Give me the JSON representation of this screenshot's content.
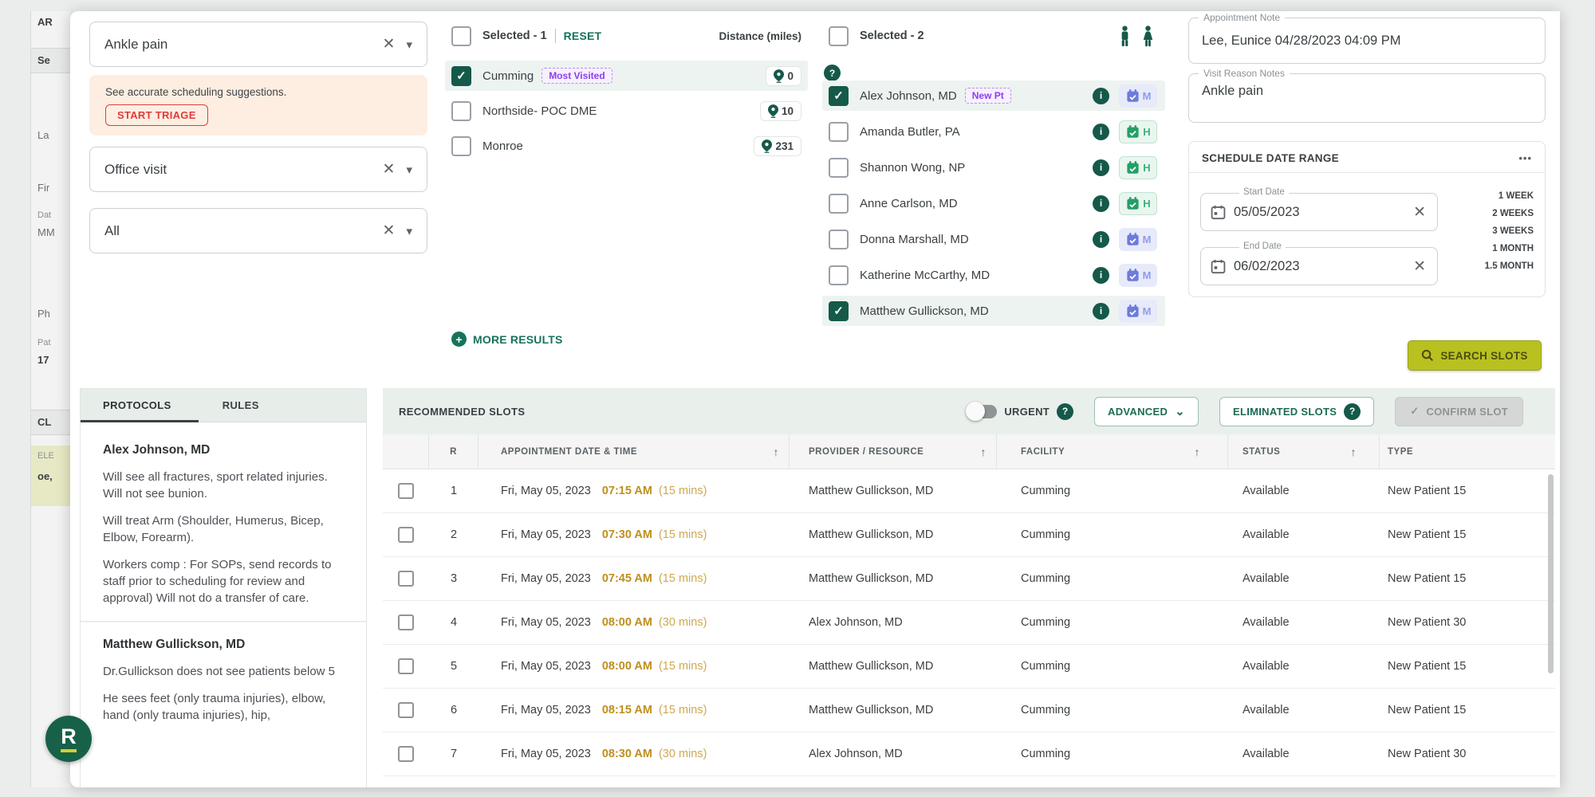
{
  "background_form": {
    "fragments": [
      "AR",
      "Se",
      "La",
      "Fir",
      "Dat",
      "MM",
      "Ph",
      "Pat",
      "17",
      "CL",
      "ELE",
      "oe,"
    ]
  },
  "filters": {
    "visit_reason": {
      "value": "Ankle pain"
    },
    "triage": {
      "message": "See accurate scheduling suggestions.",
      "button": "START TRIAGE"
    },
    "appointment_type": {
      "value": "Office visit"
    },
    "provider_type": {
      "value": "All"
    }
  },
  "locations": {
    "selected_label": "Selected  - 1",
    "reset_label": "RESET",
    "distance_header": "Distance (miles)",
    "more_results_label": "MORE RESULTS",
    "items": [
      {
        "name": "Cumming",
        "badge": "Most Visited",
        "distance": "0"
      },
      {
        "name": "Northside- POC DME",
        "distance": "10"
      },
      {
        "name": "Monroe",
        "distance": "231"
      }
    ]
  },
  "providers": {
    "selected_label": "Selected  - 2",
    "items": [
      {
        "name": "Alex Johnson, MD",
        "badge": "New Pt",
        "calendar_letter": "M"
      },
      {
        "name": "Amanda Butler, PA",
        "calendar_letter": "H"
      },
      {
        "name": "Shannon Wong, NP",
        "calendar_letter": "H"
      },
      {
        "name": "Anne Carlson, MD",
        "calendar_letter": "H"
      },
      {
        "name": "Donna Marshall, MD",
        "calendar_letter": "M"
      },
      {
        "name": "Katherine McCarthy, MD",
        "calendar_letter": "M"
      },
      {
        "name": "Matthew Gullickson, MD",
        "calendar_letter": "M"
      }
    ]
  },
  "notes": {
    "appointment_note": {
      "label": "Appointment Note",
      "value": "Lee, Eunice 04/28/2023 04:09 PM"
    },
    "visit_reason_notes": {
      "label": "Visit Reason Notes",
      "value": "Ankle pain"
    }
  },
  "date_range": {
    "title": "SCHEDULE DATE RANGE",
    "start": {
      "label": "Start Date",
      "value": "05/05/2023"
    },
    "end": {
      "label": "End Date",
      "value": "06/02/2023"
    },
    "quick_links": [
      "1 WEEK",
      "2 WEEKS",
      "3 WEEKS",
      "1 MONTH",
      "1.5 MONTH"
    ]
  },
  "search_button_label": "SEARCH SLOTS",
  "protocols": {
    "tabs": [
      {
        "label": "PROTOCOLS"
      },
      {
        "label": "RULES"
      }
    ],
    "sections": [
      {
        "provider": "Alex Johnson, MD",
        "paragraphs": [
          "Will see all fractures, sport related injuries. Will not see bunion.",
          "Will treat Arm (Shoulder, Humerus, Bicep, Elbow, Forearm).",
          "Workers comp : For SOPs, send records to staff prior to scheduling for review and approval) Will not do a transfer of care."
        ]
      },
      {
        "provider": "Matthew Gullickson, MD",
        "paragraphs": [
          "Dr.Gullickson does not see patients below 5",
          "He sees feet (only trauma injuries), elbow, hand (only trauma injuries), hip,"
        ]
      }
    ]
  },
  "slots": {
    "title": "RECOMMENDED SLOTS",
    "urgent_label": "URGENT",
    "advanced_label": "ADVANCED",
    "eliminated_label": "ELIMINATED SLOTS",
    "confirm_label": "CONFIRM SLOT",
    "columns": {
      "r": "R",
      "appointment": "APPOINTMENT DATE & TIME",
      "provider": "PROVIDER / RESOURCE",
      "facility": "FACILITY",
      "status": "STATUS",
      "type": "TYPE"
    },
    "rows": [
      {
        "r": "1",
        "date": "Fri, May 05, 2023",
        "time": "07:15 AM",
        "duration": "(15 mins)",
        "provider": "Matthew Gullickson, MD",
        "facility": "Cumming",
        "status": "Available",
        "type": "New Patient 15"
      },
      {
        "r": "2",
        "date": "Fri, May 05, 2023",
        "time": "07:30 AM",
        "duration": "(15 mins)",
        "provider": "Matthew Gullickson, MD",
        "facility": "Cumming",
        "status": "Available",
        "type": "New Patient 15"
      },
      {
        "r": "3",
        "date": "Fri, May 05, 2023",
        "time": "07:45 AM",
        "duration": "(15 mins)",
        "provider": "Matthew Gullickson, MD",
        "facility": "Cumming",
        "status": "Available",
        "type": "New Patient 15"
      },
      {
        "r": "4",
        "date": "Fri, May 05, 2023",
        "time": "08:00 AM",
        "duration": "(30 mins)",
        "provider": "Alex Johnson, MD",
        "facility": "Cumming",
        "status": "Available",
        "type": "New Patient 30"
      },
      {
        "r": "5",
        "date": "Fri, May 05, 2023",
        "time": "08:00 AM",
        "duration": "(15 mins)",
        "provider": "Matthew Gullickson, MD",
        "facility": "Cumming",
        "status": "Available",
        "type": "New Patient 15"
      },
      {
        "r": "6",
        "date": "Fri, May 05, 2023",
        "time": "08:15 AM",
        "duration": "(15 mins)",
        "provider": "Matthew Gullickson, MD",
        "facility": "Cumming",
        "status": "Available",
        "type": "New Patient 15"
      },
      {
        "r": "7",
        "date": "Fri, May 05, 2023",
        "time": "08:30 AM",
        "duration": "(30 mins)",
        "provider": "Alex Johnson, MD",
        "facility": "Cumming",
        "status": "Available",
        "type": "New Patient 30"
      }
    ]
  },
  "logo_letter": "R",
  "icons": {
    "clear": "✕",
    "caret": "▾",
    "check": "✓",
    "sort": "↑",
    "question": "?",
    "info": "i",
    "ellipsis": "•••",
    "chevron": "⌄",
    "plus": "+"
  },
  "colors": {
    "primary_green": "#15594a",
    "link_green": "#16735b",
    "accent_olive": "#b8c120",
    "badge_purple": "#8a3ff0",
    "alert_red": "#e23b3b",
    "time_amber": "#bf8f1c",
    "row_highlight": "#edf3f0"
  }
}
